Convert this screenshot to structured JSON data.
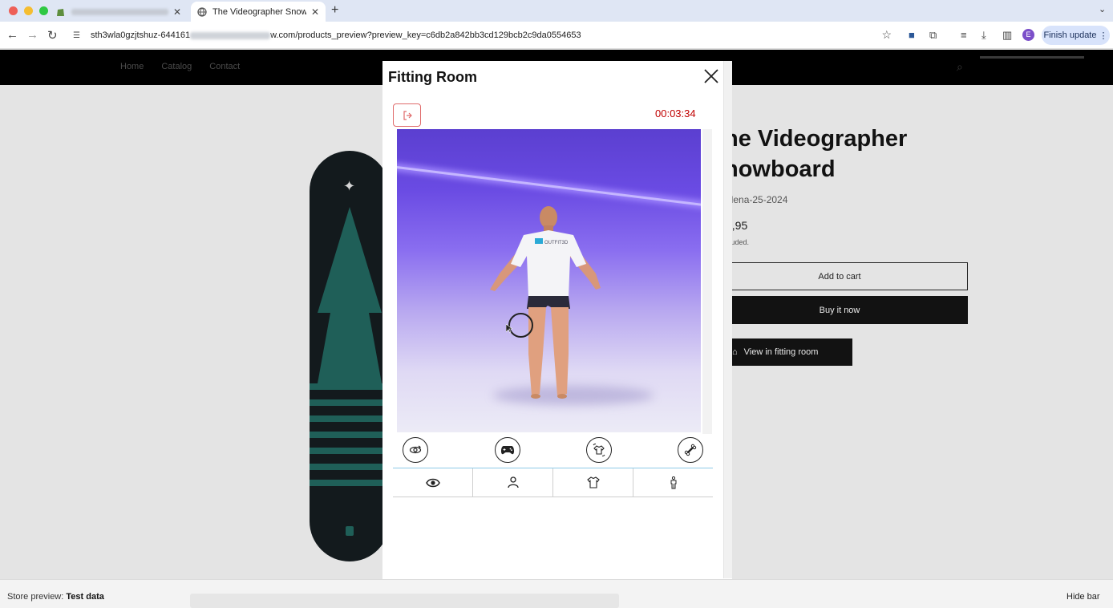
{
  "browser": {
    "tabs": [
      {
        "title": "",
        "active": false
      },
      {
        "title": "The Videographer Snowboard",
        "active": true
      }
    ],
    "url_prefix": "sth3wla0gzjtshuz-644161",
    "url_suffix": "w.com/products_preview?preview_key=c6db2a842bb3cd129bcb2c9da0554653",
    "avatar_initial": "E",
    "finish_update": "Finish update"
  },
  "store": {
    "nav": [
      "Home",
      "Catalog",
      "Contact"
    ],
    "product_title": "he Videographer nowboard",
    "vendor": "elena-25-2024",
    "price": "5,95",
    "tax_note": "cluded.",
    "add_to_cart": "Add to cart",
    "buy_now": "Buy it now",
    "fitting_room_button": "View in fitting room"
  },
  "modal": {
    "title": "Fitting Room",
    "timer": "00:03:34",
    "controls": [
      "rotate-360-icon",
      "gamepad-icon",
      "shirt-swap-icon",
      "bone-icon"
    ],
    "tabs": [
      "eye-icon",
      "person-icon",
      "tshirt-icon",
      "body-icon"
    ],
    "shirt_logo": "OUTFIT3D",
    "colors": {
      "timer": "#c00000",
      "accent_border": "#8fc9e8",
      "exit_border": "#e06b6b"
    }
  },
  "preview_bar": {
    "label": "Store preview:",
    "value": "Test data",
    "hide": "Hide bar"
  }
}
